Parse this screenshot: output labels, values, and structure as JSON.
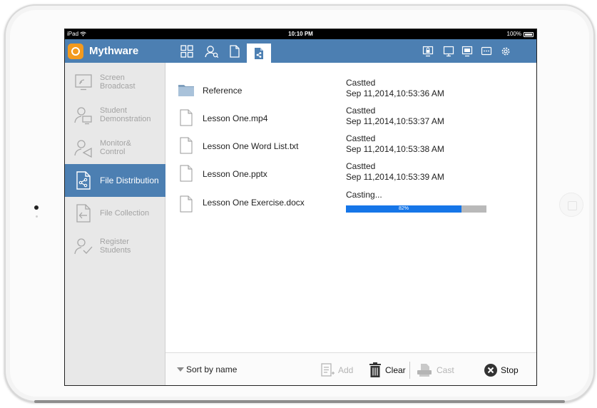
{
  "status_bar": {
    "carrier": "iPad",
    "time": "10:10 PM",
    "battery": "100%"
  },
  "app": {
    "name": "Mythware"
  },
  "colors": {
    "accent": "#4c7fb2",
    "brand": "#f39a1e",
    "progress": "#1676e8"
  },
  "top_nav": {
    "tabs": [
      {
        "icon": "grid-icon"
      },
      {
        "icon": "user-search-icon"
      },
      {
        "icon": "document-icon"
      },
      {
        "icon": "file-share-icon",
        "active": true
      }
    ],
    "tools": [
      {
        "icon": "screen-lock-icon"
      },
      {
        "icon": "monitor-icon"
      },
      {
        "icon": "screen-broadcast-icon"
      },
      {
        "icon": "message-icon"
      },
      {
        "icon": "gear-icon"
      }
    ]
  },
  "sidebar": {
    "items": [
      {
        "label1": "Screen",
        "label2": "Broadcast",
        "icon": "screen-broadcast-icon"
      },
      {
        "label1": "Student",
        "label2": "Demonstration",
        "icon": "student-demo-icon"
      },
      {
        "label1": "Monitor&",
        "label2": "Control",
        "icon": "monitor-control-icon"
      },
      {
        "label1": "File Distribution",
        "label2": "",
        "icon": "file-distribution-icon",
        "active": true
      },
      {
        "label1": "File Collection",
        "label2": "",
        "icon": "file-collection-icon"
      },
      {
        "label1": "Register",
        "label2": "Students",
        "icon": "register-students-icon"
      }
    ]
  },
  "files": [
    {
      "name": "Reference",
      "type": "folder",
      "status": "Castted",
      "time": "Sep 11,2014,10:53:36 AM"
    },
    {
      "name": "Lesson One.mp4",
      "type": "file",
      "status": "Castted",
      "time": "Sep 11,2014,10:53:37 AM"
    },
    {
      "name": "Lesson One Word List.txt",
      "type": "file",
      "status": "Castted",
      "time": "Sep 11,2014,10:53:38 AM"
    },
    {
      "name": "Lesson One.pptx",
      "type": "file",
      "status": "Castted",
      "time": "Sep 11,2014,10:53:39 AM"
    },
    {
      "name": "Lesson One Exercise.docx",
      "type": "file",
      "status": "Casting...",
      "progress": 0.82,
      "progress_label": "82%"
    }
  ],
  "bottom_bar": {
    "sort_label": "Sort by name",
    "add_label": "Add",
    "clear_label": "Clear",
    "cast_label": "Cast",
    "stop_label": "Stop"
  }
}
